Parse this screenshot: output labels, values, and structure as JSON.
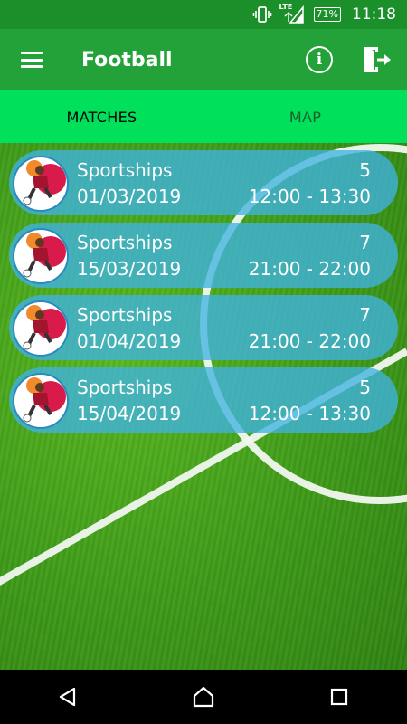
{
  "status_bar": {
    "network": "LTE",
    "battery": "71%",
    "time": "11:18"
  },
  "app_bar": {
    "title": "Football",
    "menu_icon": "hamburger-menu-icon",
    "info_icon": "info-icon",
    "exit_icon": "exit-door-icon"
  },
  "tabs": [
    {
      "label": "MATCHES",
      "active": true
    },
    {
      "label": "MAP",
      "active": false
    }
  ],
  "matches": [
    {
      "name": "Sportships",
      "date": "01/03/2019",
      "count": "5",
      "time": "12:00 - 13:30"
    },
    {
      "name": "Sportships",
      "date": "15/03/2019",
      "count": "7",
      "time": "21:00 - 22:00"
    },
    {
      "name": "Sportships",
      "date": "01/04/2019",
      "count": "7",
      "time": "21:00 - 22:00"
    },
    {
      "name": "Sportships",
      "date": "15/04/2019",
      "count": "5",
      "time": "12:00 - 13:30"
    }
  ],
  "colors": {
    "status_bar": "#1a8f2a",
    "app_bar": "#22a238",
    "tab_bar": "#00e05a",
    "card": "#40b2e1"
  },
  "nav_bar": {
    "back_icon": "back-triangle-icon",
    "home_icon": "home-icon",
    "recents_icon": "recents-square-icon"
  }
}
